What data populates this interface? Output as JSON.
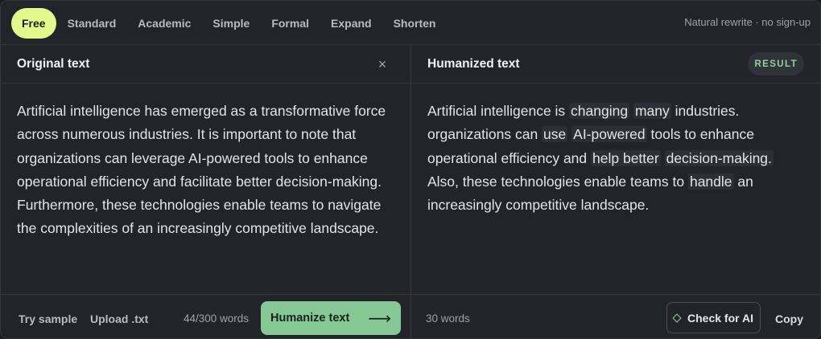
{
  "modes": [
    {
      "label": "Free",
      "active": true
    },
    {
      "label": "Standard",
      "active": false
    },
    {
      "label": "Academic",
      "active": false
    },
    {
      "label": "Simple",
      "active": false
    },
    {
      "label": "Formal",
      "active": false
    },
    {
      "label": "Expand",
      "active": false
    },
    {
      "label": "Shorten",
      "active": false
    }
  ],
  "tagline": "Natural rewrite · no sign-up",
  "original": {
    "title": "Original text",
    "close_icon": "×",
    "text": "Artificial intelligence has emerged as a transformative force across numerous industries. It is important to note that organizations can leverage AI-powered tools to enhance operational efficiency and facilitate better decision-making. Furthermore, these technologies enable teams to navigate the complexities of an increasingly competitive landscape.",
    "try_sample": "Try sample",
    "upload": "Upload .txt",
    "word_count": "44/300 words",
    "humanize_label": "Humanize text",
    "humanize_arrow": "⟶"
  },
  "humanized": {
    "title": "Humanized text",
    "badge": "RESULT",
    "segments": [
      {
        "t": "Artificial intelligence is ",
        "hl": false
      },
      {
        "t": "changing",
        "hl": true
      },
      {
        "t": " ",
        "hl": false
      },
      {
        "t": "many",
        "hl": true
      },
      {
        "t": " industries. organizations can ",
        "hl": false
      },
      {
        "t": "use",
        "hl": true
      },
      {
        "t": " ",
        "hl": false
      },
      {
        "t": "AI-powered",
        "hl": true
      },
      {
        "t": " tools to enhance operational efficiency and ",
        "hl": false
      },
      {
        "t": "help better",
        "hl": true
      },
      {
        "t": " ",
        "hl": false
      },
      {
        "t": "decision-making.",
        "hl": true
      },
      {
        "t": " Also, these technologies enable teams to ",
        "hl": false
      },
      {
        "t": "handle",
        "hl": true
      },
      {
        "t": " an increasingly competitive landscape.",
        "hl": false
      }
    ],
    "word_count": "30 words",
    "check_label": "Check for AI",
    "copy_label": "Copy"
  },
  "colors": {
    "accent": "#e4f98b",
    "success": "#86c796",
    "badge_text": "#8fd39a"
  }
}
